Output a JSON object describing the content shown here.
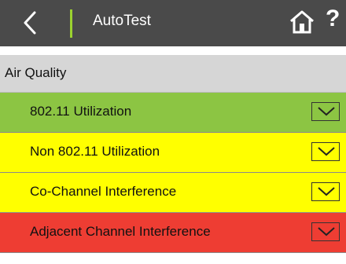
{
  "header": {
    "title": "AutoTest"
  },
  "section": {
    "title": "Air Quality"
  },
  "rows": [
    {
      "label": "802.11 Utilization",
      "color": "#8cc543"
    },
    {
      "label": "Non 802.11 Utilization",
      "color": "#ffff00"
    },
    {
      "label": "Co-Channel Interference",
      "color": "#ffff00"
    },
    {
      "label": "Adjacent Channel Interference",
      "color": "#ee3d33"
    }
  ],
  "icons": {
    "back": "back-arrow-icon",
    "home": "home-icon",
    "help": "help-icon",
    "chevron": "chevron-down-icon"
  },
  "help_symbol": "?"
}
